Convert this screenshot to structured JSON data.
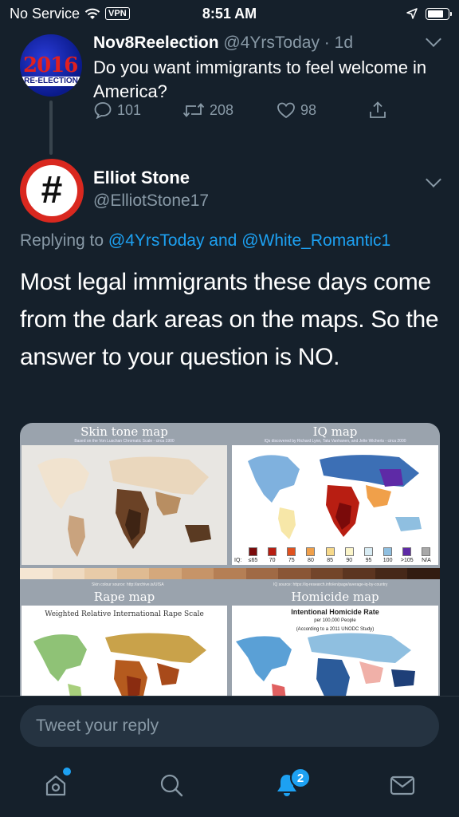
{
  "status_bar": {
    "carrier": "No Service",
    "vpn": "VPN",
    "time": "8:51 AM",
    "battery_level": 0.8
  },
  "tweet1": {
    "avatar": {
      "year": "2016",
      "band": "RE-ELECTION"
    },
    "name": "Nov8Reelection",
    "handle": "@4YrsToday",
    "sep": "·",
    "age": "1d",
    "text": "Do you want immigrants to feel welcome in America?",
    "replies": "101",
    "retweets": "208",
    "likes": "98"
  },
  "tweet2": {
    "name": "Elliot Stone",
    "handle": "@ElliotStone17",
    "replying_prefix": "Replying to",
    "replying_to_1": "@4YrsToday",
    "replying_and": "and",
    "replying_to_2": "@White_Romantic1",
    "text": "Most legal immigrants these days come from the dark areas on the maps. So the answer to your question is NO."
  },
  "media": {
    "skin": {
      "title": "Skin tone map",
      "subtitle": "Based on the Von Luschan Chromatic Scale - circa 1900"
    },
    "iq": {
      "title": "IQ map",
      "subtitle": "IQs discovered by Richard Lynn, Tatu Vanhanen, and Jelte Wicherts - circa 2000"
    },
    "iq_legend": {
      "label": "IQ:",
      "items": [
        {
          "label": "≤65",
          "color": "#7a0a0a"
        },
        {
          "label": "70",
          "color": "#b81e12"
        },
        {
          "label": "75",
          "color": "#e0521f"
        },
        {
          "label": "80",
          "color": "#f0a04a"
        },
        {
          "label": "85",
          "color": "#f7d98a"
        },
        {
          "label": "90",
          "color": "#fbf5c9"
        },
        {
          "label": "95",
          "color": "#d8ecf4"
        },
        {
          "label": "100",
          "color": "#8fbfe0"
        },
        {
          "label": ">105",
          "color": "#5e2aa6"
        },
        {
          "label": "N/A",
          "color": "#a8a8a8"
        }
      ]
    },
    "skin_source": "Skin colour source: http://archive.is/UISA",
    "iq_source": "IQ source: https://iq-research.info/en/page/average-iq-by-country",
    "rape": {
      "title": "Rape map",
      "subtitle": "Weighted Relative International Rape Scale"
    },
    "homicide": {
      "title": "Homicide map",
      "subtitle": "Intentional Homicide Rate",
      "line2": "per 100,000 People",
      "line3": "(According to a 2011 UNODC Study)"
    }
  },
  "compose": {
    "placeholder": "Tweet your reply"
  },
  "tabs": {
    "notifications_badge": "2"
  }
}
